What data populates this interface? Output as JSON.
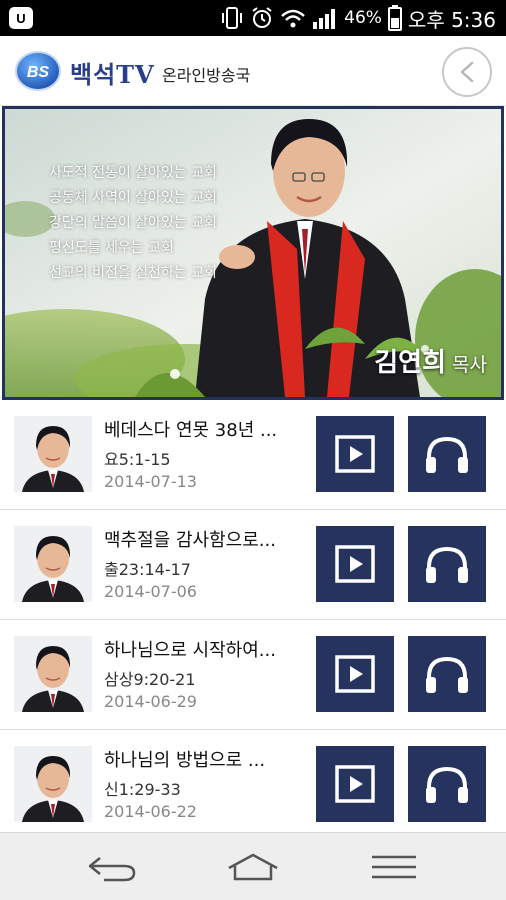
{
  "status_bar": {
    "battery": "46%",
    "time": "오후 5:36",
    "icons": [
      "notification-icon",
      "vibrate-icon",
      "alarm-icon",
      "wifi-icon",
      "signal-icon",
      "battery-icon"
    ]
  },
  "header": {
    "logo_text": "BS",
    "brand": "백석TV",
    "subtitle": "온라인방송국",
    "back_icon": "back-arrow-icon"
  },
  "banner": {
    "slogans": [
      "사도적 전통이 살아있는 교회",
      "공동체 사역이 살아있는 교회",
      "강단의 말씀이 살아있는 교회",
      "평신도를 세우는 교회",
      "선교의 비전을 실천하는 교회"
    ],
    "pastor_name": "김연희",
    "pastor_title": "목사"
  },
  "sermons": [
    {
      "title": "베데스다 연못 38년 ...",
      "reference": "요5:1-15",
      "date": "2014-07-13"
    },
    {
      "title": "맥추절을 감사함으로...",
      "reference": "출23:14-17",
      "date": "2014-07-06"
    },
    {
      "title": "하나님으로 시작하여...",
      "reference": "삼상9:20-21",
      "date": "2014-06-29"
    },
    {
      "title": "하나님의 방법으로 ...",
      "reference": "신1:29-33",
      "date": "2014-06-22"
    }
  ],
  "colors": {
    "brand_blue": "#2a3f8c",
    "button_navy": "#25335e",
    "stole_red": "#d8281f"
  },
  "nav": {
    "icons": [
      "back-icon",
      "home-icon",
      "menu-icon"
    ]
  }
}
